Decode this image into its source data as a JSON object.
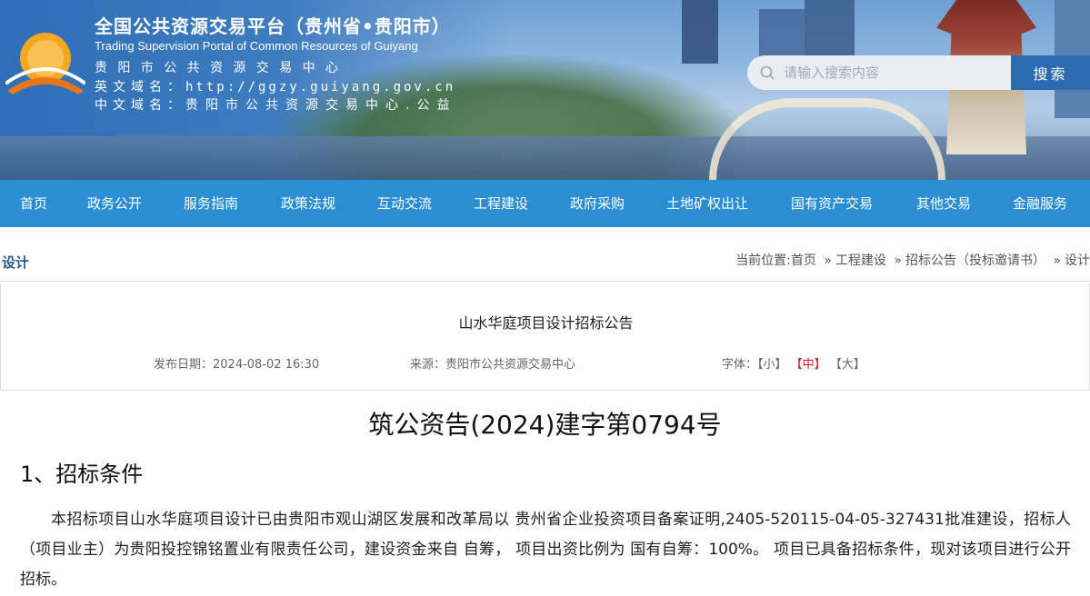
{
  "header": {
    "title_cn": "全国公共资源交易平台（贵州省•贵阳市）",
    "title_en": "Trading Supervision Portal of Common Resources of Guiyang",
    "center_name": "贵阳市公共资源交易中心",
    "en_domain_label": "英文域名：",
    "en_domain_value": "http://ggzy.guiyang.gov.cn",
    "cn_domain_label": "中文域名：",
    "cn_domain_value": "贵阳市公共资源交易中心.公益",
    "search_placeholder": "请输入搜索内容",
    "search_button": "搜索"
  },
  "nav": {
    "items": [
      {
        "label": "首页"
      },
      {
        "label": "政务公开"
      },
      {
        "label": "服务指南"
      },
      {
        "label": "政策法规"
      },
      {
        "label": "互动交流"
      },
      {
        "label": "工程建设"
      },
      {
        "label": "政府采购"
      },
      {
        "label": "土地矿权出让"
      },
      {
        "label": "国有资产交易"
      },
      {
        "label": "其他交易"
      },
      {
        "label": "金融服务"
      }
    ]
  },
  "location": {
    "section_tag": "设计",
    "prefix": "当前位置:",
    "crumbs": [
      "首页",
      "工程建设",
      "招标公告（投标邀请书）",
      "设计"
    ],
    "separator": "»"
  },
  "article": {
    "title": "山水华庭项目设计招标公告",
    "date_label": "发布日期：",
    "date_value": "2024-08-02 16:30",
    "source_label": "来源：",
    "source_value": "贵阳市公共资源交易中心",
    "font_label": "字体：",
    "font_small": "【小】",
    "font_medium": "【中】",
    "font_large": "【大】",
    "active_font_color": "#d21b1b",
    "doc_number": "筑公资告(2024)建字第0794号",
    "section1_heading": "1、招标条件",
    "section1_body": "本招标项目山水华庭项目设计已由贵阳市观山湖区发展和改革局以 贵州省企业投资项目备案证明,2405-520115-04-05-327431批准建设，招标人（项目业主）为贵阳投控锦铭置业有限责任公司，建设资金来自 自筹， 项目出资比例为 国有自筹：100%。 项目已具备招标条件，现对该项目进行公开招标。"
  },
  "colors": {
    "nav_bg": "#2b8ed3",
    "search_button_bg": "#2b6bb0",
    "section_tag": "#2a5a8a"
  }
}
